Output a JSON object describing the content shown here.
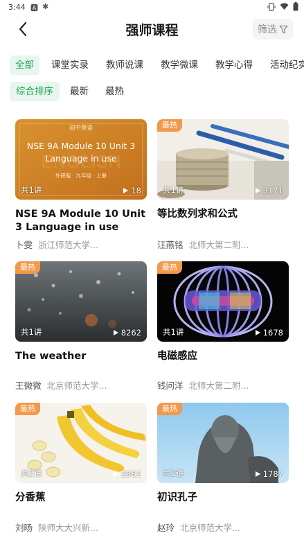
{
  "status_bar": {
    "time": "3:44"
  },
  "header": {
    "title": "强师课程",
    "filter_label": "筛选"
  },
  "tabs": [
    {
      "label": "全部",
      "active": true
    },
    {
      "label": "课堂实录",
      "active": false
    },
    {
      "label": "教师说课",
      "active": false
    },
    {
      "label": "教学微课",
      "active": false
    },
    {
      "label": "教学心得",
      "active": false
    },
    {
      "label": "活动纪实",
      "active": false
    }
  ],
  "sort_options": [
    {
      "label": "综合排序",
      "active": true
    },
    {
      "label": "最新",
      "active": false
    },
    {
      "label": "最热",
      "active": false
    }
  ],
  "courses": [
    {
      "title": "NSE 9A Module 10 Unit 3 Language in use",
      "badge": "",
      "lectures": "共1讲",
      "views": "18",
      "teacher": "卜雯",
      "school": "浙江师范大学...",
      "thumb_header": "初中英语",
      "thumb_title": "NSE 9A Module 10 Unit 3 Language in use",
      "thumb_footer": "外研版 · 九年级 · 上册",
      "thumb_watermark": "ENGLISH"
    },
    {
      "title": "等比数列求和公式",
      "badge": "最热",
      "lectures": "共1讲",
      "views": "3171",
      "teacher": "汪燕铭",
      "school": "北师大第二附..."
    },
    {
      "title": "The weather",
      "badge": "最热",
      "lectures": "共1讲",
      "views": "8262",
      "teacher": "王微微",
      "school": "北京师范大学..."
    },
    {
      "title": "电磁感应",
      "badge": "最热",
      "lectures": "共1讲",
      "views": "1678",
      "teacher": "钱问洋",
      "school": "北师大第二附..."
    },
    {
      "title": "分香蕉",
      "badge": "最热",
      "lectures": "共2讲",
      "views": "2861",
      "teacher": "刘旸",
      "school": "陕师大大兴新..."
    },
    {
      "title": "初识孔子",
      "badge": "最热",
      "lectures": "共2讲",
      "views": "1787",
      "teacher": "赵玲",
      "school": "北京师范大学..."
    }
  ],
  "colors": {
    "accent_green": "#22a85a",
    "accent_bg": "#e8f6ee",
    "badge_orange": "#f29a4a"
  },
  "icons": [
    "back-arrow-icon",
    "filter-funnel-icon",
    "play-icon",
    "wifi-icon",
    "battery-icon",
    "vibrate-icon"
  ]
}
